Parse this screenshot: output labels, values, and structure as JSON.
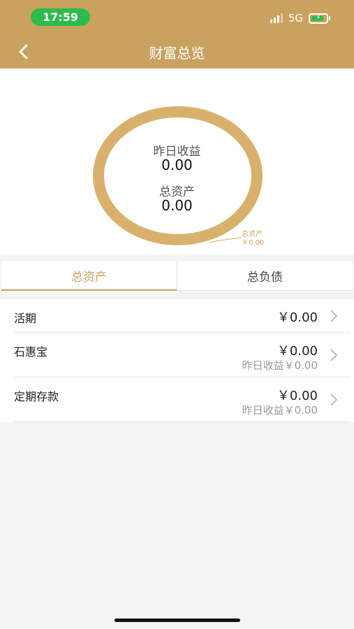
{
  "status_bar": {
    "time": "17:59",
    "network": "5G"
  },
  "header": {
    "title": "财富总览"
  },
  "summary": {
    "yesterday_label": "昨日收益",
    "yesterday_value": "0.00",
    "total_label": "总资产",
    "total_value": "0.00",
    "callout_label": "总资产",
    "callout_value": "￥0.00",
    "ring_color": "#d8b26c"
  },
  "tabs": [
    {
      "label": "总资产",
      "active": true
    },
    {
      "label": "总负债",
      "active": false
    }
  ],
  "accounts": [
    {
      "name": "活期",
      "amount": "￥0.00"
    },
    {
      "name": "石惠宝",
      "amount": "￥0.00",
      "sub": "昨日收益￥0.00"
    },
    {
      "name": "定期存款",
      "amount": "￥0.00",
      "sub": "昨日收益￥0.00"
    }
  ],
  "colors": {
    "accent": "#c9a25f",
    "time_pill": "#2dbb4d"
  }
}
